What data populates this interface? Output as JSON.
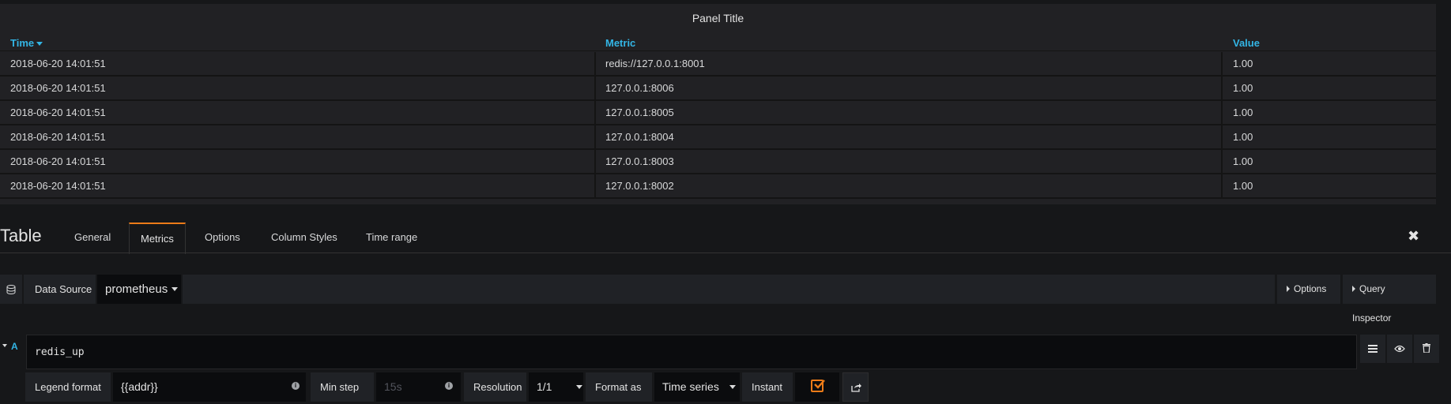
{
  "panel": {
    "title": "Panel Title",
    "columns": [
      {
        "label": "Time",
        "sorted": true
      },
      {
        "label": "Metric"
      },
      {
        "label": "Value"
      }
    ],
    "rows": [
      [
        "2018-06-20 14:01:51",
        "redis://127.0.0.1:8001",
        "1.00"
      ],
      [
        "2018-06-20 14:01:51",
        "127.0.0.1:8006",
        "1.00"
      ],
      [
        "2018-06-20 14:01:51",
        "127.0.0.1:8005",
        "1.00"
      ],
      [
        "2018-06-20 14:01:51",
        "127.0.0.1:8004",
        "1.00"
      ],
      [
        "2018-06-20 14:01:51",
        "127.0.0.1:8003",
        "1.00"
      ],
      [
        "2018-06-20 14:01:51",
        "127.0.0.1:8002",
        "1.00"
      ]
    ]
  },
  "editor": {
    "title": "Table",
    "tabs": [
      "General",
      "Metrics",
      "Options",
      "Column Styles",
      "Time range"
    ],
    "active_tab": "Metrics",
    "close_glyph": "✖"
  },
  "datasource": {
    "label": "Data Source",
    "value": "prometheus",
    "options_button": "Options",
    "inspector_button": "Query Inspector"
  },
  "query": {
    "ref": "A",
    "expr": "redis_up",
    "legend_label": "Legend format",
    "legend_value": "{{addr}}",
    "min_step_label": "Min step",
    "min_step_placeholder": "15s",
    "resolution_label": "Resolution",
    "resolution_value": "1/1",
    "format_label": "Format as",
    "format_value": "Time series",
    "instant_label": "Instant",
    "instant_checked": true
  },
  "colors": {
    "accent": "#eb7b18",
    "link": "#33b5e5"
  }
}
